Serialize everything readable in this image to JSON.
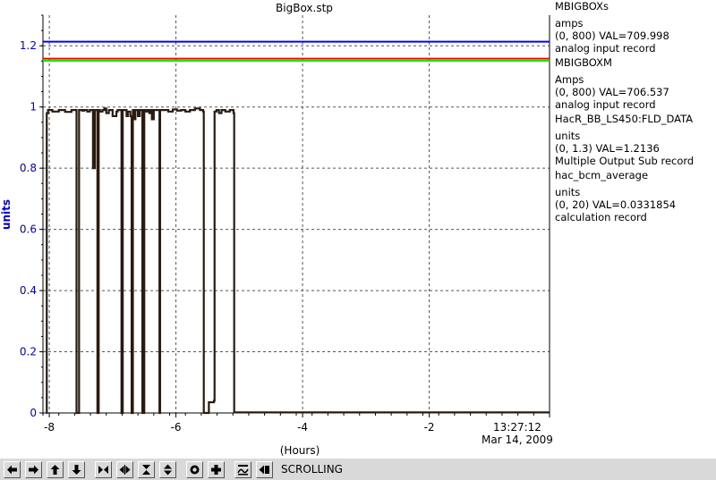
{
  "chart_data": {
    "type": "line",
    "title": "BigBox.stp",
    "xlabel": "(Hours)",
    "ylabel": "units",
    "xlim": [
      -8.1,
      -0.1
    ],
    "ylim": [
      0,
      1.3
    ],
    "x_ticks": [
      -8,
      -6,
      -4,
      -2
    ],
    "x_tick_labels": [
      "-8",
      "-6",
      "-4",
      "-2"
    ],
    "y_ticks": [
      0,
      0.2,
      0.4,
      0.6,
      0.8,
      1,
      1.2
    ],
    "y_tick_labels": [
      "0",
      "0.2",
      "0.4",
      "0.6",
      "0.8",
      "1",
      "1.2"
    ],
    "time_label": "13:27:12",
    "date_label": "Mar 14, 2009",
    "grid": true,
    "series": [
      {
        "name": "MBIGBOXs",
        "color": "#ff0000",
        "x": [
          -8.1,
          -0.1
        ],
        "y": [
          1.158,
          1.158
        ]
      },
      {
        "name": "MBIGBOXM",
        "color": "#00ee00",
        "x": [
          -8.1,
          -0.1
        ],
        "y": [
          1.151,
          1.151
        ]
      },
      {
        "name": "HacR_BB_LS450:FLD_DATA",
        "color": "#0000ff",
        "x": [
          -8.1,
          -0.1
        ],
        "y": [
          1.2136,
          1.2136
        ]
      },
      {
        "name": "hac_bcm_average",
        "color": "#2a1a10",
        "x": [
          -8.05,
          -8.04,
          -8.02,
          -7.95,
          -7.85,
          -7.75,
          -7.65,
          -7.58,
          -7.57,
          -7.54,
          -7.53,
          -7.48,
          -7.45,
          -7.4,
          -7.36,
          -7.34,
          -7.31,
          -7.28,
          -7.27,
          -7.24,
          -7.22,
          -7.2,
          -7.16,
          -7.13,
          -7.1,
          -7.06,
          -7.0,
          -6.94,
          -6.92,
          -6.88,
          -6.86,
          -6.84,
          -6.82,
          -6.78,
          -6.76,
          -6.72,
          -6.7,
          -6.68,
          -6.66,
          -6.64,
          -6.62,
          -6.6,
          -6.57,
          -6.54,
          -6.53,
          -6.5,
          -6.48,
          -6.45,
          -6.42,
          -6.4,
          -6.38,
          -6.35,
          -6.32,
          -6.28,
          -6.26,
          -6.25,
          -6.22,
          -6.18,
          -6.12,
          -6.05,
          -5.98,
          -5.92,
          -5.85,
          -5.78,
          -5.7,
          -5.62,
          -5.57,
          -5.56,
          -5.52,
          -5.48,
          -5.42,
          -5.4,
          -5.39,
          -5.36,
          -5.32,
          -5.28,
          -5.22,
          -5.15,
          -5.1,
          -5.09,
          -5.08,
          -0.1
        ],
        "y": [
          0,
          0.98,
          0.99,
          0.985,
          0.99,
          0.984,
          0.99,
          0.99,
          0,
          0,
          0.99,
          0.988,
          0.99,
          0.985,
          0.99,
          0.99,
          0.8,
          0.99,
          0.99,
          0,
          0.99,
          0.985,
          0.99,
          0.995,
          0.98,
          0.99,
          0.97,
          0.985,
          0.99,
          0.99,
          0,
          0.99,
          0.99,
          0.97,
          0.985,
          0.97,
          0,
          0.99,
          0.96,
          0.99,
          0.99,
          0.97,
          0.99,
          0.99,
          0,
          0.99,
          0.985,
          0.99,
          0.98,
          0.99,
          0.96,
          0.99,
          0.99,
          0.99,
          0,
          0.99,
          0.99,
          0.99,
          0.985,
          0.992,
          0.988,
          0.99,
          0.985,
          0.99,
          0.995,
          0.99,
          0.985,
          0,
          0,
          0.035,
          0.035,
          0.04,
          0.985,
          0.99,
          0.98,
          0.99,
          0.985,
          0.99,
          0.99,
          0.98,
          0.002,
          0.002
        ]
      }
    ]
  },
  "legend": [
    {
      "name": "MBIGBOXs",
      "color": "#ff0000",
      "unit": "amps",
      "range_val": "(0, 800)  VAL=709.998",
      "record": "analog input record"
    },
    {
      "name": "MBIGBOXM",
      "color": "#00ee00",
      "unit": "Amps",
      "range_val": "(0, 800) VAL=706.537",
      "record": "analog input record"
    },
    {
      "name": "HacR_BB_LS450:FLD_DATA",
      "color": "#0000ff",
      "unit": "units",
      "range_val": "(0, 1.3) VAL=1.2136",
      "record": "Multiple Output Sub record"
    },
    {
      "name": "hac_bcm_average",
      "color": "#2a1a10",
      "unit": "units",
      "range_val": "(0, 20) VAL=0.0331854",
      "record": "calculation record"
    }
  ],
  "toolbar": {
    "buttons": [
      "arrow-left-icon",
      "arrow-right-icon",
      "arrow-up-icon",
      "arrow-down-icon",
      "zoom-in-horizontal-icon",
      "zoom-out-horizontal-icon",
      "zoom-in-vertical-icon",
      "zoom-out-vertical-icon",
      "auto-scale-icon",
      "crosshair-icon",
      "reset-scale-icon",
      "scroll-mode-icon"
    ],
    "mode_label": "SCROLLING"
  }
}
